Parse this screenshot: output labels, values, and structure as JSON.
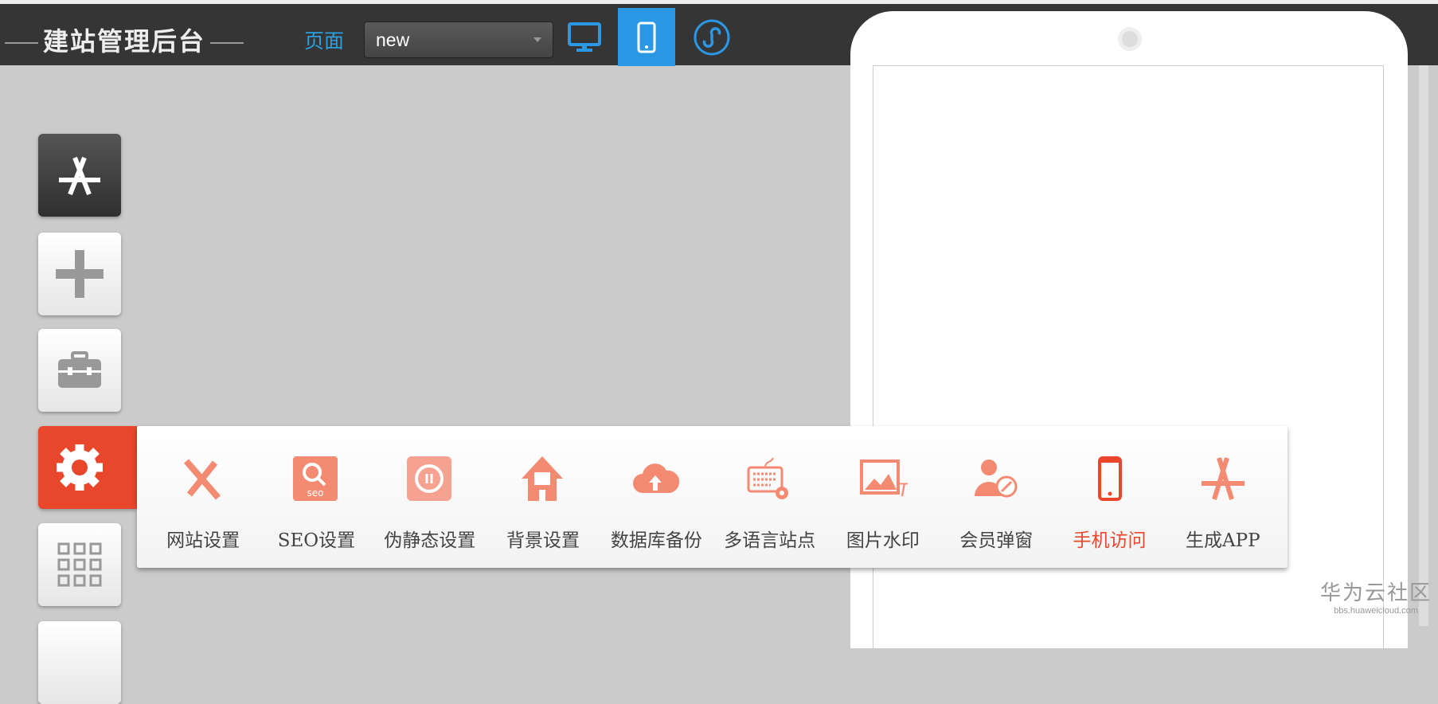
{
  "header": {
    "title": "建站管理后台",
    "page_label": "页面",
    "page_select": "new"
  },
  "devices": [
    {
      "icon": "desktop-icon"
    },
    {
      "icon": "mobile-icon",
      "active": true
    },
    {
      "icon": "mini-program-icon"
    }
  ],
  "sidebar": [
    {
      "icon": "app-store-icon"
    },
    {
      "icon": "plus-icon"
    },
    {
      "icon": "toolbox-icon"
    },
    {
      "icon": "gear-icon",
      "active": true
    },
    {
      "icon": "grid-icon"
    }
  ],
  "settings_menu": [
    {
      "label": "网站设置",
      "icon": "tools-icon"
    },
    {
      "label": "SEO设置",
      "icon": "seo-icon"
    },
    {
      "label": "伪静态设置",
      "icon": "rewrite-icon"
    },
    {
      "label": "背景设置",
      "icon": "background-icon"
    },
    {
      "label": "数据库备份",
      "icon": "cloud-upload-icon"
    },
    {
      "label": "多语言站点",
      "icon": "keyboard-gear-icon"
    },
    {
      "label": "图片水印",
      "icon": "image-watermark-icon"
    },
    {
      "label": "会员弹窗",
      "icon": "member-popup-icon"
    },
    {
      "label": "手机访问",
      "icon": "mobile-icon",
      "active": true
    },
    {
      "label": "生成APP",
      "icon": "app-store-icon"
    }
  ],
  "watermark": {
    "title": "华为云社区",
    "url": "bbs.huaweicloud.com"
  },
  "colors": {
    "accent": "#e8472b",
    "blue": "#2b98e6",
    "icon": "#f58a72"
  }
}
